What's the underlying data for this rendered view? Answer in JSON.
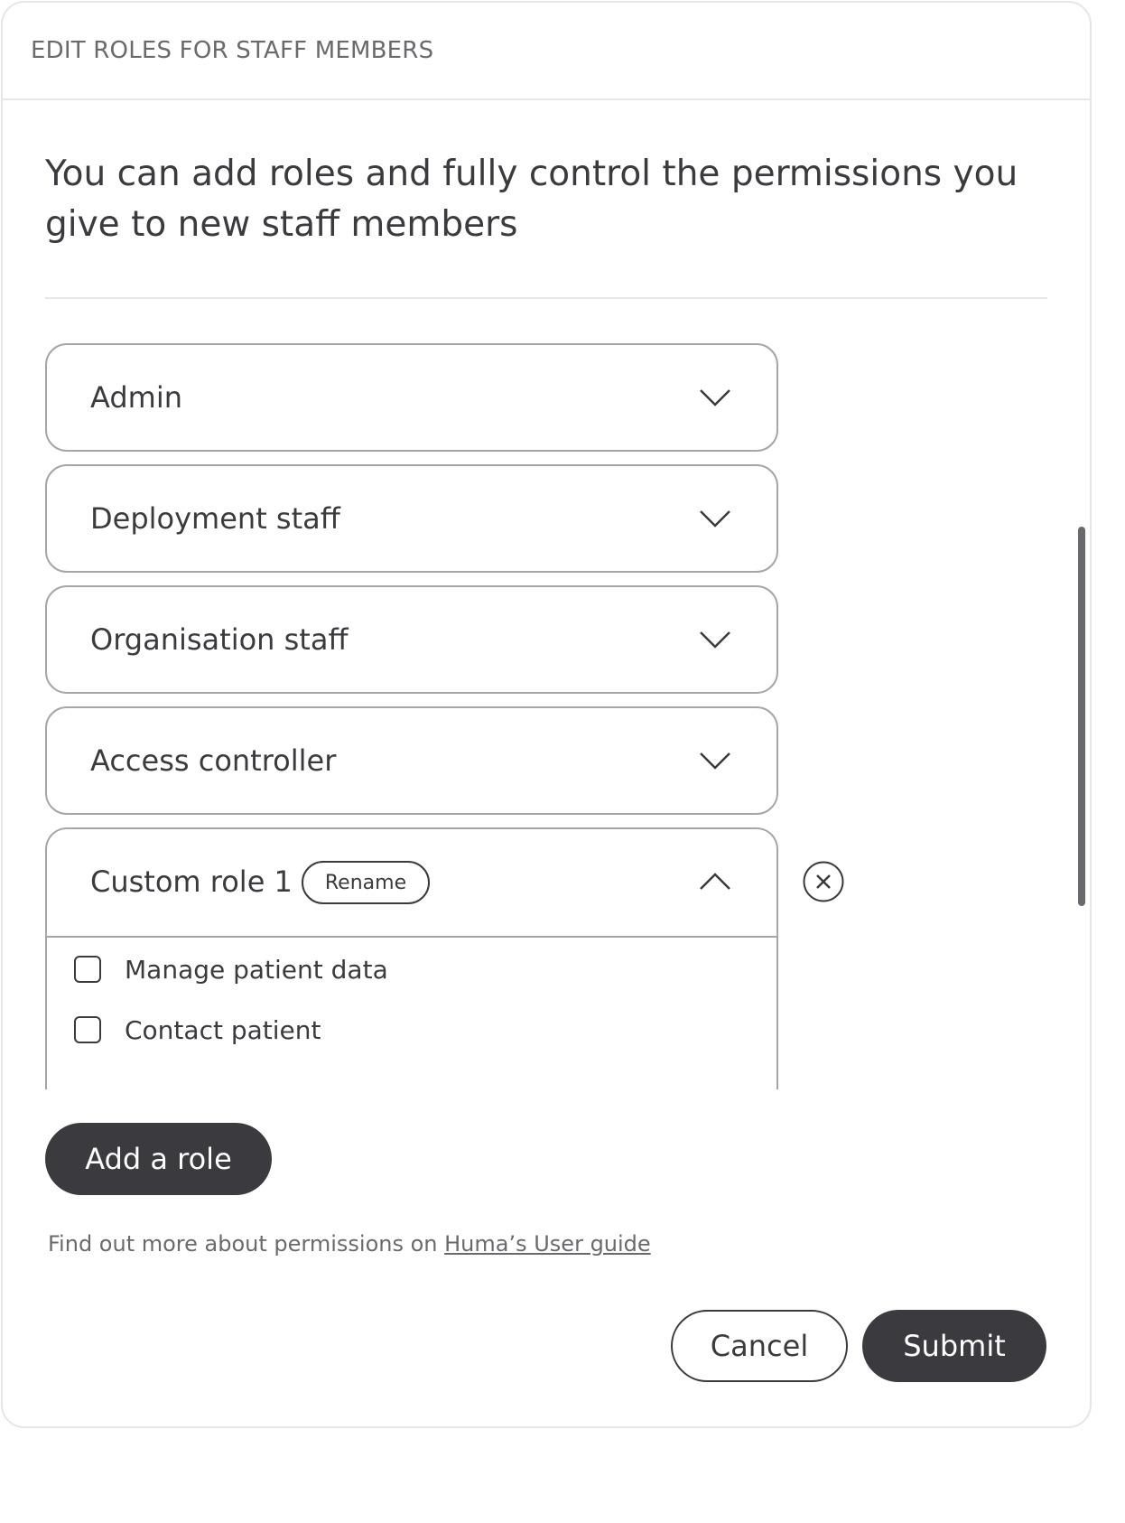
{
  "dialog": {
    "title": "EDIT ROLES FOR STAFF MEMBERS",
    "intro": "You can add roles and fully control the permissions you give to new staff members"
  },
  "roles": [
    {
      "label": "Admin",
      "icon": "chevron-down-icon"
    },
    {
      "label": "Deployment staff",
      "icon": "chevron-down-icon"
    },
    {
      "label": "Organisation staff",
      "icon": "chevron-down-icon"
    },
    {
      "label": "Access controller",
      "icon": "chevron-down-icon"
    }
  ],
  "custom_role": {
    "label": "Custom role 1",
    "rename_label": "Rename",
    "icon": "chevron-up-icon",
    "remove_icon": "close-circle-icon",
    "permissions": [
      {
        "label": "Manage patient data",
        "checked": false
      },
      {
        "label": "Contact patient",
        "checked": false
      }
    ]
  },
  "actions": {
    "add_role_label": "Add a role",
    "cancel_label": "Cancel",
    "submit_label": "Submit"
  },
  "footer": {
    "note_prefix": "Find out more about permissions on ",
    "link_text": "Huma’s User guide"
  },
  "colors": {
    "primary_dark": "#3b3b3f",
    "border": "#a6a6aa",
    "muted_text": "#6a6a6e",
    "divider": "#e6e6e6"
  }
}
